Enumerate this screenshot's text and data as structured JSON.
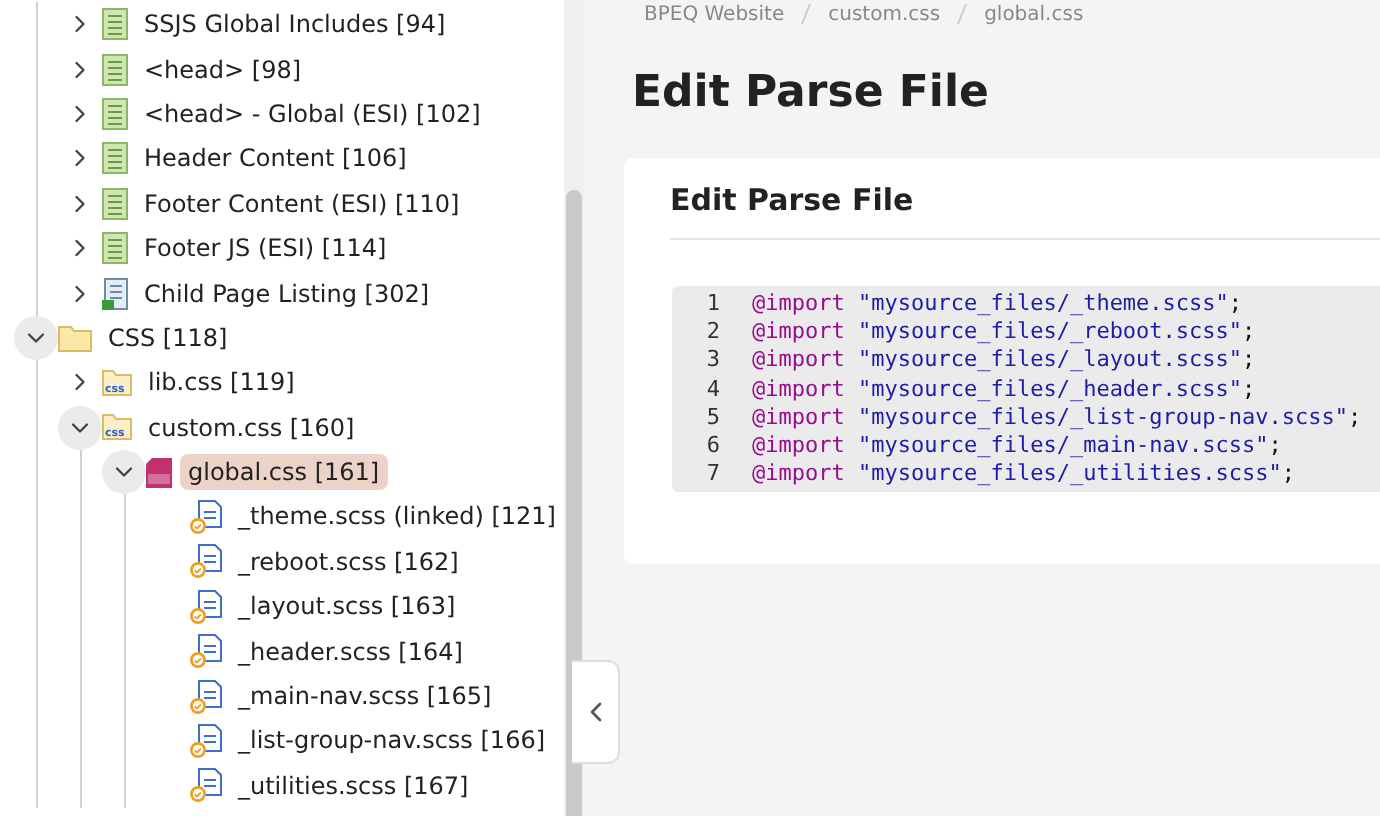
{
  "sidebar": {
    "tree_continued": [
      {
        "label": "SSJS Global Includes [94]",
        "kind": "page",
        "expanded": false,
        "selected": false
      },
      {
        "label": "<head> [98]",
        "kind": "page",
        "expanded": false,
        "selected": false
      },
      {
        "label": "<head> - Global (ESI) [102]",
        "kind": "page",
        "expanded": false,
        "selected": false
      },
      {
        "label": "Header Content [106]",
        "kind": "page",
        "expanded": false,
        "selected": false
      },
      {
        "label": "Footer Content (ESI) [110]",
        "kind": "page",
        "expanded": false,
        "selected": false
      },
      {
        "label": "Footer JS (ESI) [114]",
        "kind": "page",
        "expanded": false,
        "selected": false
      },
      {
        "label": "Child Page Listing [302]",
        "kind": "listing",
        "expanded": false,
        "selected": false
      }
    ],
    "tree": [
      {
        "label": "CSS [118]",
        "kind": "folder",
        "expanded": true,
        "selected": false,
        "children": [
          {
            "label": "lib.css [119]",
            "kind": "css",
            "expanded": false,
            "selected": false
          },
          {
            "label": "custom.css [160]",
            "kind": "css",
            "expanded": true,
            "selected": false,
            "children": [
              {
                "label": "global.css [161]",
                "kind": "scss",
                "expanded": true,
                "selected": true,
                "children": [
                  {
                    "label": "_theme.scss (linked) [121]",
                    "kind": "linked-css",
                    "selected": false
                  },
                  {
                    "label": "_reboot.scss [162]",
                    "kind": "linked-css",
                    "selected": false
                  },
                  {
                    "label": "_layout.scss [163]",
                    "kind": "linked-css",
                    "selected": false
                  },
                  {
                    "label": "_header.scss [164]",
                    "kind": "linked-css",
                    "selected": false
                  },
                  {
                    "label": "_main-nav.scss [165]",
                    "kind": "linked-css",
                    "selected": false
                  },
                  {
                    "label": "_list-group-nav.scss [166]",
                    "kind": "linked-css",
                    "selected": false
                  },
                  {
                    "label": "_utilities.scss [167]",
                    "kind": "linked-css",
                    "selected": false
                  }
                ]
              }
            ]
          }
        ]
      }
    ]
  },
  "breadcrumbs": [
    "BPEQ Website",
    "custom.css",
    "global.css"
  ],
  "page_title": "Edit Parse File",
  "card": {
    "title": "Edit Parse File",
    "code_lines": [
      {
        "number": "1",
        "keyword": "@import",
        "string": "\"mysource_files/_theme.scss\"",
        "punct": ";"
      },
      {
        "number": "2",
        "keyword": "@import",
        "string": "\"mysource_files/_reboot.scss\"",
        "punct": ";"
      },
      {
        "number": "3",
        "keyword": "@import",
        "string": "\"mysource_files/_layout.scss\"",
        "punct": ";"
      },
      {
        "number": "4",
        "keyword": "@import",
        "string": "\"mysource_files/_header.scss\"",
        "punct": ";"
      },
      {
        "number": "5",
        "keyword": "@import",
        "string": "\"mysource_files/_list-group-nav.scss\"",
        "punct": ";"
      },
      {
        "number": "6",
        "keyword": "@import",
        "string": "\"mysource_files/_main-nav.scss\"",
        "punct": ";"
      },
      {
        "number": "7",
        "keyword": "@import",
        "string": "\"mysource_files/_utilities.scss\"",
        "punct": ";"
      }
    ]
  }
}
